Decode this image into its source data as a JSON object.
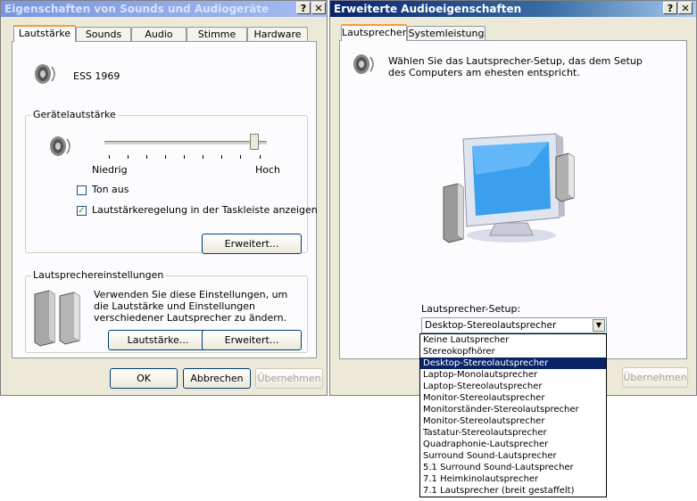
{
  "left_window": {
    "title": "Eigenschaften von Sounds und Audiogeräte",
    "help_btn": "?",
    "close_btn": "✕",
    "tabs": [
      "Lautstärke",
      "Sounds",
      "Audio",
      "Stimme",
      "Hardware"
    ],
    "device_name": "ESS 1969",
    "device_volume_group": "Gerätelautstärke",
    "slider_low": "Niedrig",
    "slider_high": "Hoch",
    "slider_level": 0.95,
    "mute_label": "Ton aus",
    "mute_checked": false,
    "taskbar_label": "Lautstärkeregelung in der Taskleiste anzeigen",
    "taskbar_checked": true,
    "advanced_btn": "Erweitert...",
    "speaker_group": "Lautsprechereinstellungen",
    "speaker_desc": "Verwenden Sie diese Einstellungen, um die Lautstärke und Einstellungen verschiedener Lautsprecher zu ändern.",
    "volume_btn": "Lautstärke...",
    "advanced_btn2": "Erweitert...",
    "ok_btn": "OK",
    "cancel_btn": "Abbrechen",
    "apply_btn": "Übernehmen"
  },
  "right_window": {
    "title": "Erweiterte Audioeigenschaften",
    "help_btn": "?",
    "close_btn": "✕",
    "tabs": [
      "Lautsprecher",
      "Systemleistung"
    ],
    "description": "Wählen Sie das Lautsprecher-Setup, das dem Setup des Computers am ehesten entspricht.",
    "setup_label": "Lautsprecher-Setup:",
    "setup_value": "Desktop-Stereolautsprecher",
    "apply_btn": "Übernehmen",
    "dropdown_options": [
      "Keine Lautsprecher",
      "Stereokopfhörer",
      "Desktop-Stereolautsprecher",
      "Laptop-Monolautsprecher",
      "Laptop-Stereolautsprecher",
      "Monitor-Stereolautsprecher",
      "Monitorständer-Stereolautsprecher",
      "Monitor-Stereolautsprecher",
      "Tastatur-Stereolautsprecher",
      "Quadraphonie-Lautsprecher",
      "Surround Sound-Lautsprecher",
      "5.1 Surround Sound-Lautsprecher",
      "7.1 Heimkinolautsprecher",
      "7.1 Lautsprecher (breit gestaffelt)"
    ],
    "selected_index": 2
  }
}
